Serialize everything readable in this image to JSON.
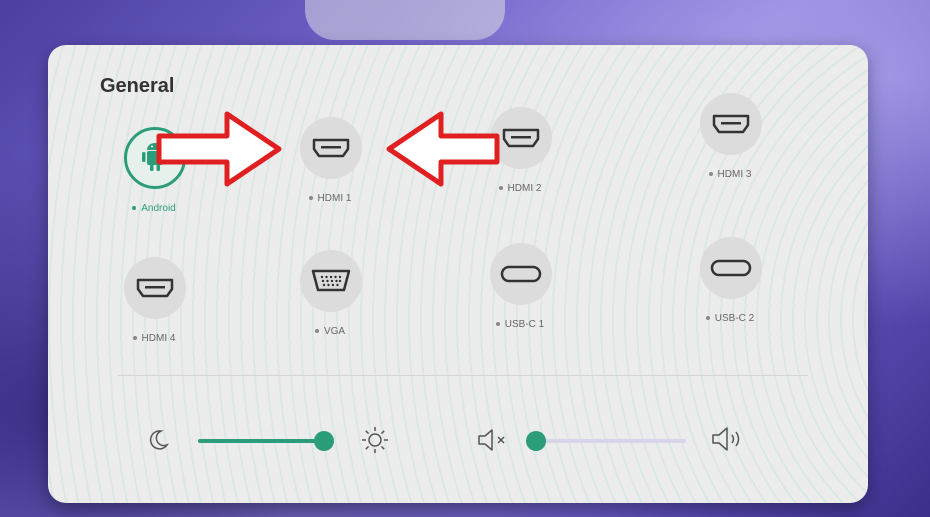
{
  "panel": {
    "section_title": "General"
  },
  "sources": [
    {
      "label": "Android",
      "icon": "android-icon",
      "active": true
    },
    {
      "label": "HDMI 1",
      "icon": "hdmi-icon",
      "active": false
    },
    {
      "label": "HDMI 2",
      "icon": "hdmi-icon",
      "active": false
    },
    {
      "label": "HDMI 3",
      "icon": "hdmi-icon",
      "active": false
    },
    {
      "label": "HDMI 4",
      "icon": "hdmi-icon",
      "active": false
    },
    {
      "label": "VGA",
      "icon": "vga-icon",
      "active": false
    },
    {
      "label": "USB-C 1",
      "icon": "usb-c-icon",
      "active": false
    },
    {
      "label": "USB-C 2",
      "icon": "usb-c-icon",
      "active": false
    }
  ],
  "controls": {
    "brightness": {
      "level_percent": 100,
      "min_icon": "moon-icon",
      "max_icon": "sun-icon"
    },
    "volume": {
      "level_percent": 0,
      "min_icon": "mute-icon",
      "max_icon": "speaker-icon"
    }
  },
  "colors": {
    "accent": "#2b9d7a",
    "annotation_arrow": "#e02020"
  }
}
